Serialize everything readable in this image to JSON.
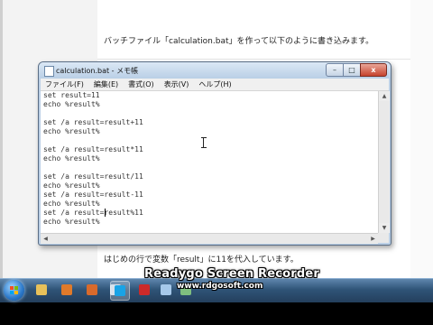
{
  "webpage": {
    "intro_text": "バッチファイル「calculation.bat」を作って以下のように書き込みます。",
    "footer_text": "はじめの行で変数「result」に11を代入しています。"
  },
  "notepad": {
    "title": "calculation.bat - メモ帳",
    "caption_buttons": {
      "minimize": "–",
      "maximize": "□",
      "close": "x"
    },
    "menu": [
      "ファイル(F)",
      "編集(E)",
      "書式(O)",
      "表示(V)",
      "ヘルプ(H)"
    ],
    "lines": [
      "set result=11",
      "echo %result%",
      "",
      "set /a result=result+11",
      "echo %result%",
      "",
      "set /a result=result*11",
      "echo %result%",
      "",
      "set /a result=result/11",
      "echo %result%",
      "set /a result=result-11",
      "echo %result%",
      "set /a result=result%11",
      "echo %result%"
    ],
    "scroll_arrows": {
      "up": "▲",
      "down": "▼",
      "left": "◀",
      "right": "▶"
    }
  },
  "taskbar": {
    "buttons": [
      {
        "icon": "windows-explorer-icon",
        "color": "#e8c15a"
      },
      {
        "icon": "media-player-icon",
        "color": "#e07a2a"
      },
      {
        "icon": "firefox-icon",
        "color": "#d86a2c"
      },
      {
        "icon": "paint-icon",
        "color": "#c9d7e6"
      },
      {
        "icon": "skype-icon",
        "color": "#19a3e6"
      },
      {
        "icon": "app-red-icon",
        "color": "#cc2a2a"
      },
      {
        "icon": "notepad-icon",
        "color": "#a6c8ea"
      },
      {
        "icon": "recorder-icon",
        "color": "#7fbf7f"
      }
    ]
  },
  "watermark": {
    "title": "Readygo Screen Recorder",
    "url": "www.rdgosoft.com"
  },
  "colors": {
    "window_frame": "#bcd0e6",
    "close_button": "#c6432e",
    "taskbar": "#2f5478"
  }
}
